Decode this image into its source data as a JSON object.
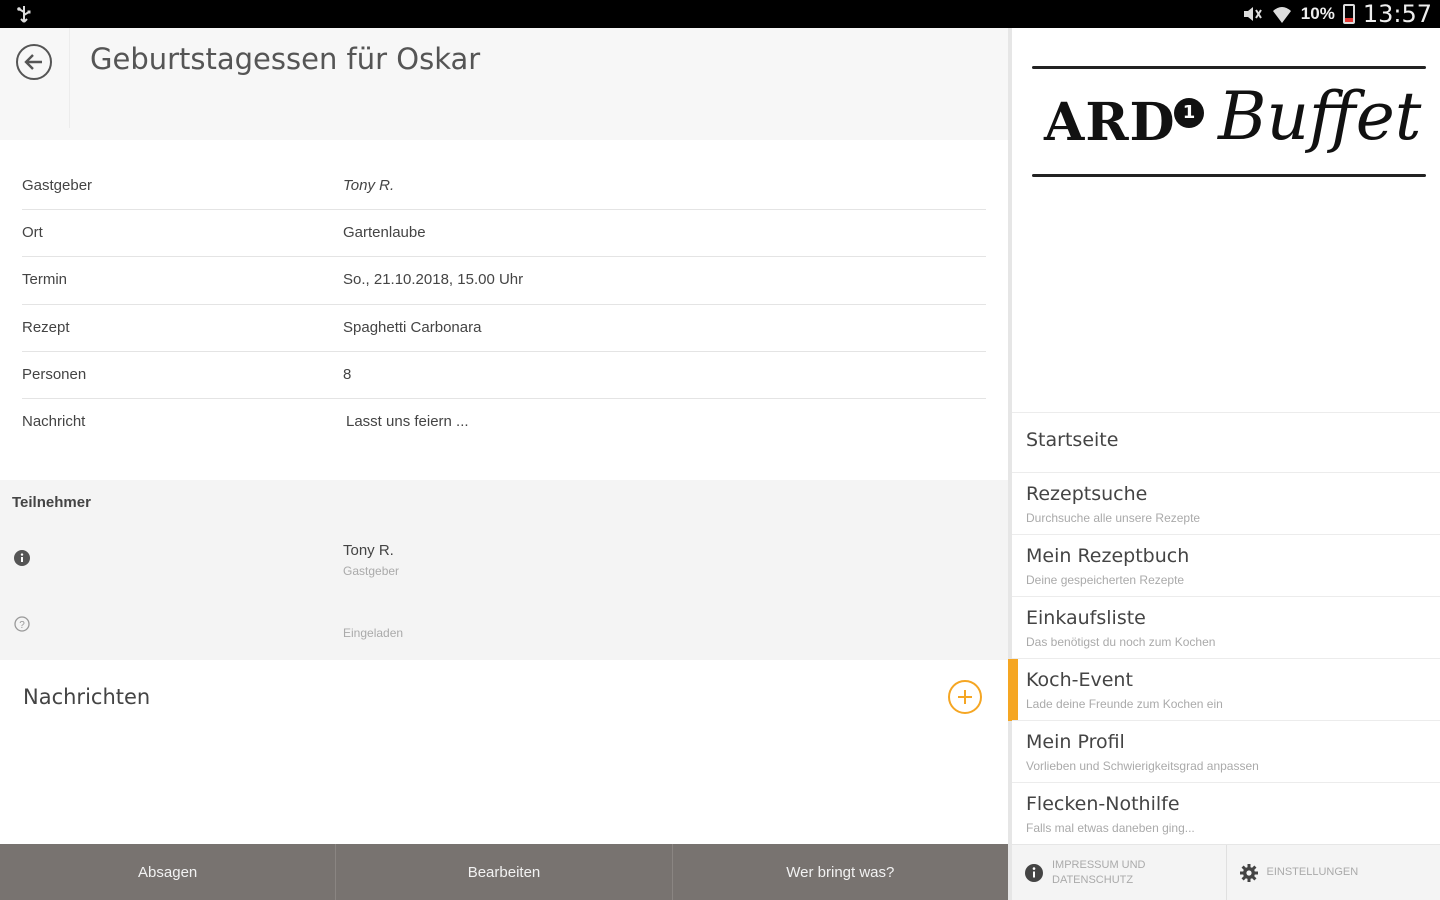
{
  "status_bar": {
    "battery_percent": "10%",
    "time": "13:57"
  },
  "header": {
    "title": "Geburtstagessen für Oskar"
  },
  "details": [
    {
      "label": "Gastgeber",
      "value": "Tony R."
    },
    {
      "label": "Ort",
      "value": "Gartenlaube"
    },
    {
      "label": "Termin",
      "value": "So., 21.10.2018, 15.00 Uhr"
    },
    {
      "label": "Rezept",
      "value": "Spaghetti Carbonara"
    },
    {
      "label": "Personen",
      "value": "8"
    },
    {
      "label": "Nachricht",
      "value": "Lasst uns feiern ..."
    }
  ],
  "participants": {
    "header": "Teilnehmer",
    "rows": [
      {
        "name": "Tony R.",
        "role": "Gastgeber",
        "icon": "info-icon"
      },
      {
        "name": "",
        "role": "Eingeladen",
        "icon": "question-icon"
      }
    ]
  },
  "messages": {
    "title": "Nachrichten"
  },
  "bottom_bar": {
    "cancel_label": "Absagen",
    "edit_label": "Bearbeiten",
    "who_brings_label": "Wer bringt was?"
  },
  "drawer": {
    "logo": {
      "ard": "ARD",
      "one": "1",
      "buffet": "Buffet"
    },
    "menu": [
      {
        "label": "Startseite",
        "sub": ""
      },
      {
        "label": "Rezeptsuche",
        "sub": "Durchsuche alle unsere Rezepte"
      },
      {
        "label": "Mein Rezeptbuch",
        "sub": "Deine gespeicherten Rezepte"
      },
      {
        "label": "Einkaufsliste",
        "sub": "Das benötigst du noch zum Kochen"
      },
      {
        "label": "Koch-Event",
        "sub": "Lade deine Freunde zum Kochen ein"
      },
      {
        "label": "Mein Profil",
        "sub": "Vorlieben und Schwierigkeitsgrad anpassen"
      },
      {
        "label": "Flecken-Nothilfe",
        "sub": "Falls mal etwas daneben ging..."
      }
    ],
    "active_item": "Koch-Event",
    "footer": {
      "imprint_line1": "Impressum und",
      "imprint_line2": "Datenschutz",
      "settings": "Einstellungen"
    }
  },
  "colors": {
    "accent": "#f5a623",
    "bottom_bar": "#787370",
    "status_bar": "#000000"
  }
}
